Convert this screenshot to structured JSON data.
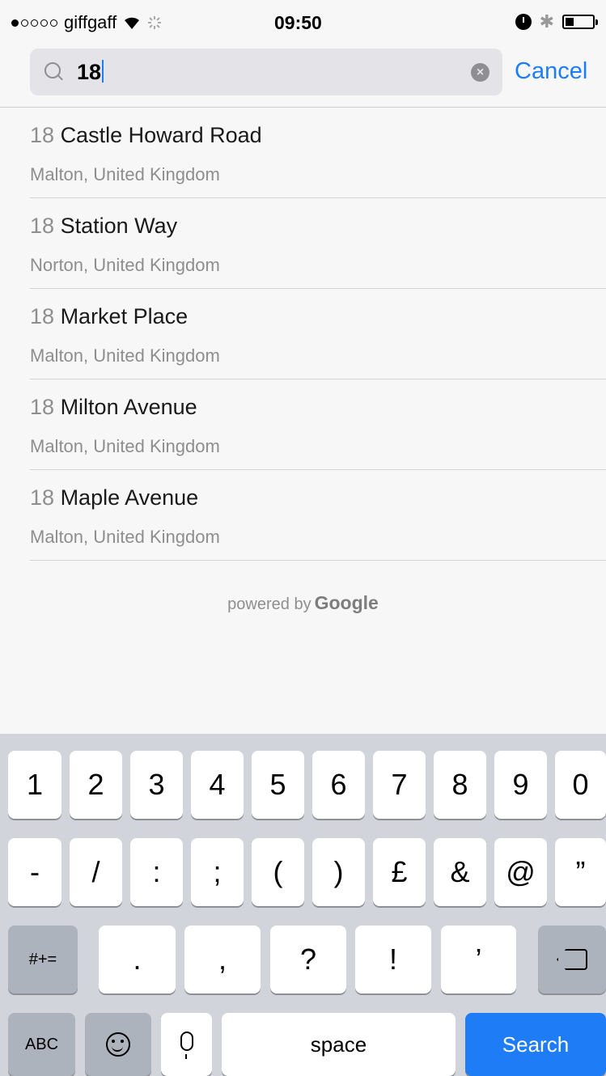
{
  "status_bar": {
    "carrier": "giffgaff",
    "signal_bars_filled": 1,
    "signal_bars_total": 5,
    "time": "09:50",
    "battery_level": 0.3
  },
  "search": {
    "query": "18",
    "cancel_label": "Cancel"
  },
  "results": [
    {
      "number": "18",
      "street": "Castle Howard Road",
      "locality": "Malton, United Kingdom"
    },
    {
      "number": "18",
      "street": "Station Way",
      "locality": "Norton, United Kingdom"
    },
    {
      "number": "18",
      "street": "Market Place",
      "locality": "Malton, United Kingdom"
    },
    {
      "number": "18",
      "street": "Milton Avenue",
      "locality": "Malton, United Kingdom"
    },
    {
      "number": "18",
      "street": "Maple Avenue",
      "locality": "Malton, United Kingdom"
    }
  ],
  "attribution": {
    "prefix": "powered by",
    "brand": "Google"
  },
  "keyboard": {
    "row1": [
      "1",
      "2",
      "3",
      "4",
      "5",
      "6",
      "7",
      "8",
      "9",
      "0"
    ],
    "row2": [
      "-",
      "/",
      ":",
      ";",
      "(",
      ")",
      "£",
      "&",
      "@",
      "”"
    ],
    "row3_mode": "#+=",
    "row3": [
      ".",
      ",",
      "?",
      "!",
      "’"
    ],
    "mode_label": "ABC",
    "space_label": "space",
    "search_label": "Search"
  },
  "colors": {
    "accent": "#1e7cf7",
    "keyboard_bg": "#d1d5db"
  }
}
